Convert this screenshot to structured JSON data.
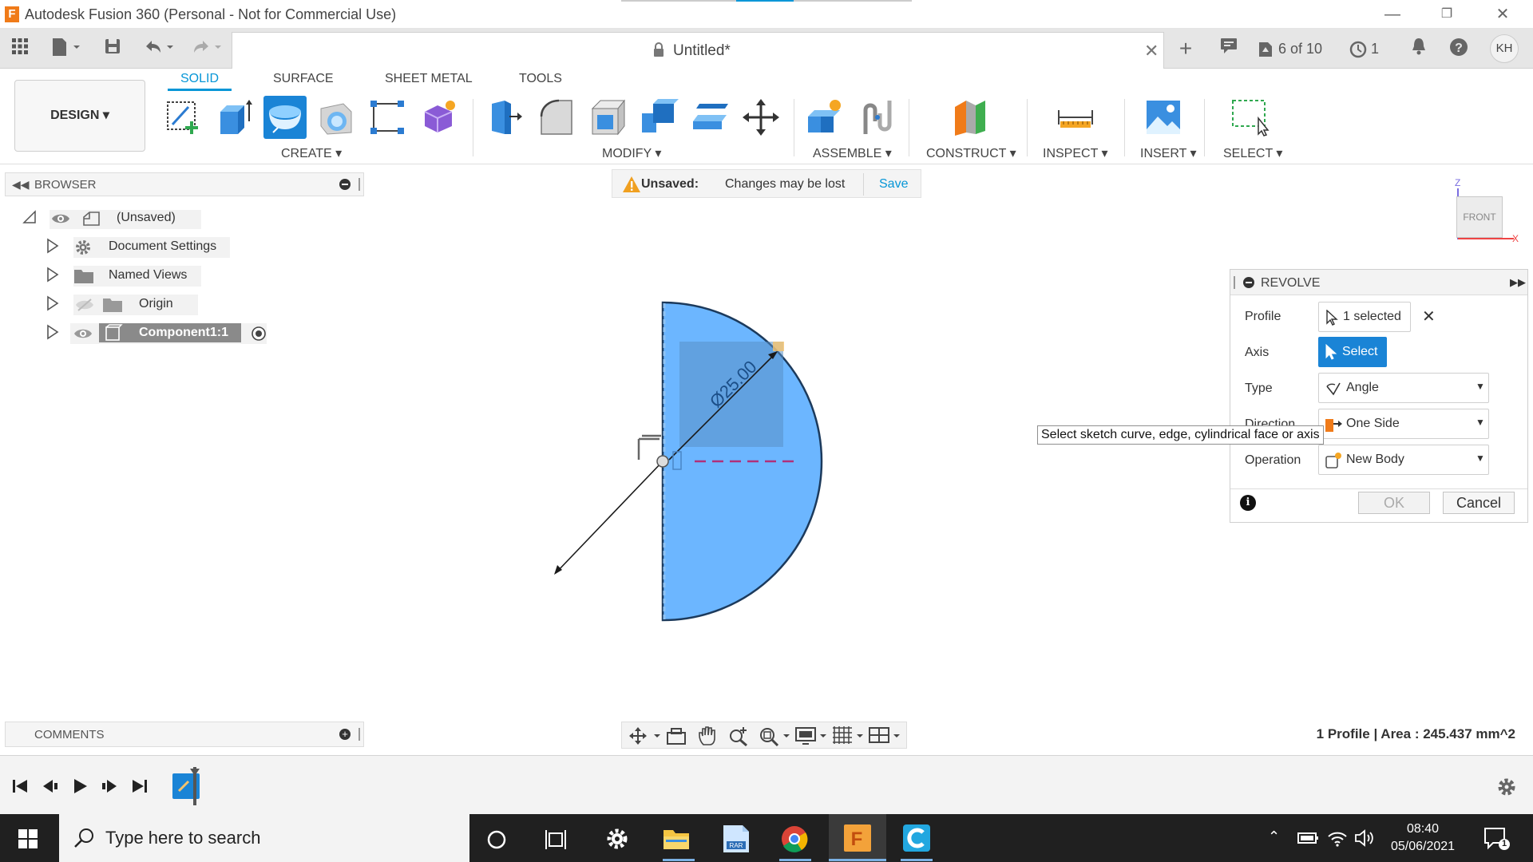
{
  "window": {
    "title": "Autodesk Fusion 360 (Personal - Not for Commercial Use)",
    "logo_letter": "F"
  },
  "qat": {
    "doc_name": "Untitled*",
    "jobs": "6 of 10",
    "clock_count": "1",
    "avatar": "KH"
  },
  "tabs": [
    "SOLID",
    "SURFACE",
    "SHEET METAL",
    "TOOLS"
  ],
  "ribbon": {
    "design": "DESIGN ▾",
    "groups": {
      "create": "CREATE ▾",
      "modify": "MODIFY ▾",
      "assemble": "ASSEMBLE ▾",
      "construct": "CONSTRUCT ▾",
      "inspect": "INSPECT ▾",
      "insert": "INSERT ▾",
      "select": "SELECT ▾"
    }
  },
  "browser": {
    "title": "BROWSER",
    "root": "(Unsaved)",
    "items": [
      "Document Settings",
      "Named Views",
      "Origin",
      "Component1:1"
    ]
  },
  "notice": {
    "label": "Unsaved:",
    "message": "Changes may be lost",
    "action": "Save"
  },
  "viewcube": {
    "face": "FRONT",
    "axis_z": "Z",
    "axis_x": "X"
  },
  "sketch": {
    "dimension": "Ø25.00"
  },
  "revolve": {
    "title": "REVOLVE",
    "profile_label": "Profile",
    "profile_value": "1 selected",
    "axis_label": "Axis",
    "axis_value": "Select",
    "type_label": "Type",
    "type_value": "Angle",
    "direction_label": "Direction",
    "direction_value": "One Side",
    "operation_label": "Operation",
    "operation_value": "New Body",
    "ok": "OK",
    "cancel": "Cancel"
  },
  "tooltip": "Select sketch curve, edge, cylindrical face or axis",
  "comments": {
    "title": "COMMENTS"
  },
  "status": "1 Profile | Area : 245.437 mm^2",
  "taskbar": {
    "search_placeholder": "Type here to search",
    "time": "08:40",
    "date": "05/06/2021",
    "notifications": "1"
  }
}
